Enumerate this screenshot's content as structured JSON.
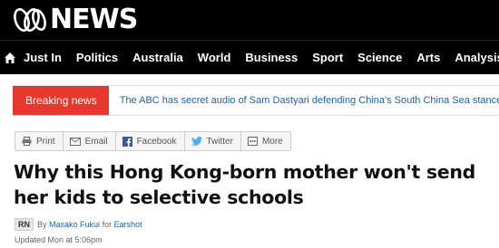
{
  "header": {
    "logo_text": "NEWS"
  },
  "nav": {
    "items": [
      "Just In",
      "Politics",
      "Australia",
      "World",
      "Business",
      "Sport",
      "Science",
      "Arts",
      "Analysis"
    ]
  },
  "breaking": {
    "label": "Breaking news",
    "text": "The ABC has secret audio of Sam Dastyari defending China's South China Sea stance, in def"
  },
  "share": {
    "buttons": [
      {
        "label": "Print",
        "icon": "print-icon"
      },
      {
        "label": "Email",
        "icon": "email-icon"
      },
      {
        "label": "Facebook",
        "icon": "facebook-icon"
      },
      {
        "label": "Twitter",
        "icon": "twitter-icon"
      },
      {
        "label": "More",
        "icon": "more-icon"
      }
    ]
  },
  "article": {
    "headline": "Why this Hong Kong-born mother won't send her kids to selective schools",
    "byline": {
      "badge": "RN",
      "by": "By",
      "author": "Masako Fukui",
      "for": "for",
      "program": "Earshot"
    },
    "updated": "Updated Mon at 5:06pm"
  },
  "colors": {
    "breaking_red": "#e8382e",
    "link_blue": "#2060a8",
    "masthead_black": "#000000"
  }
}
